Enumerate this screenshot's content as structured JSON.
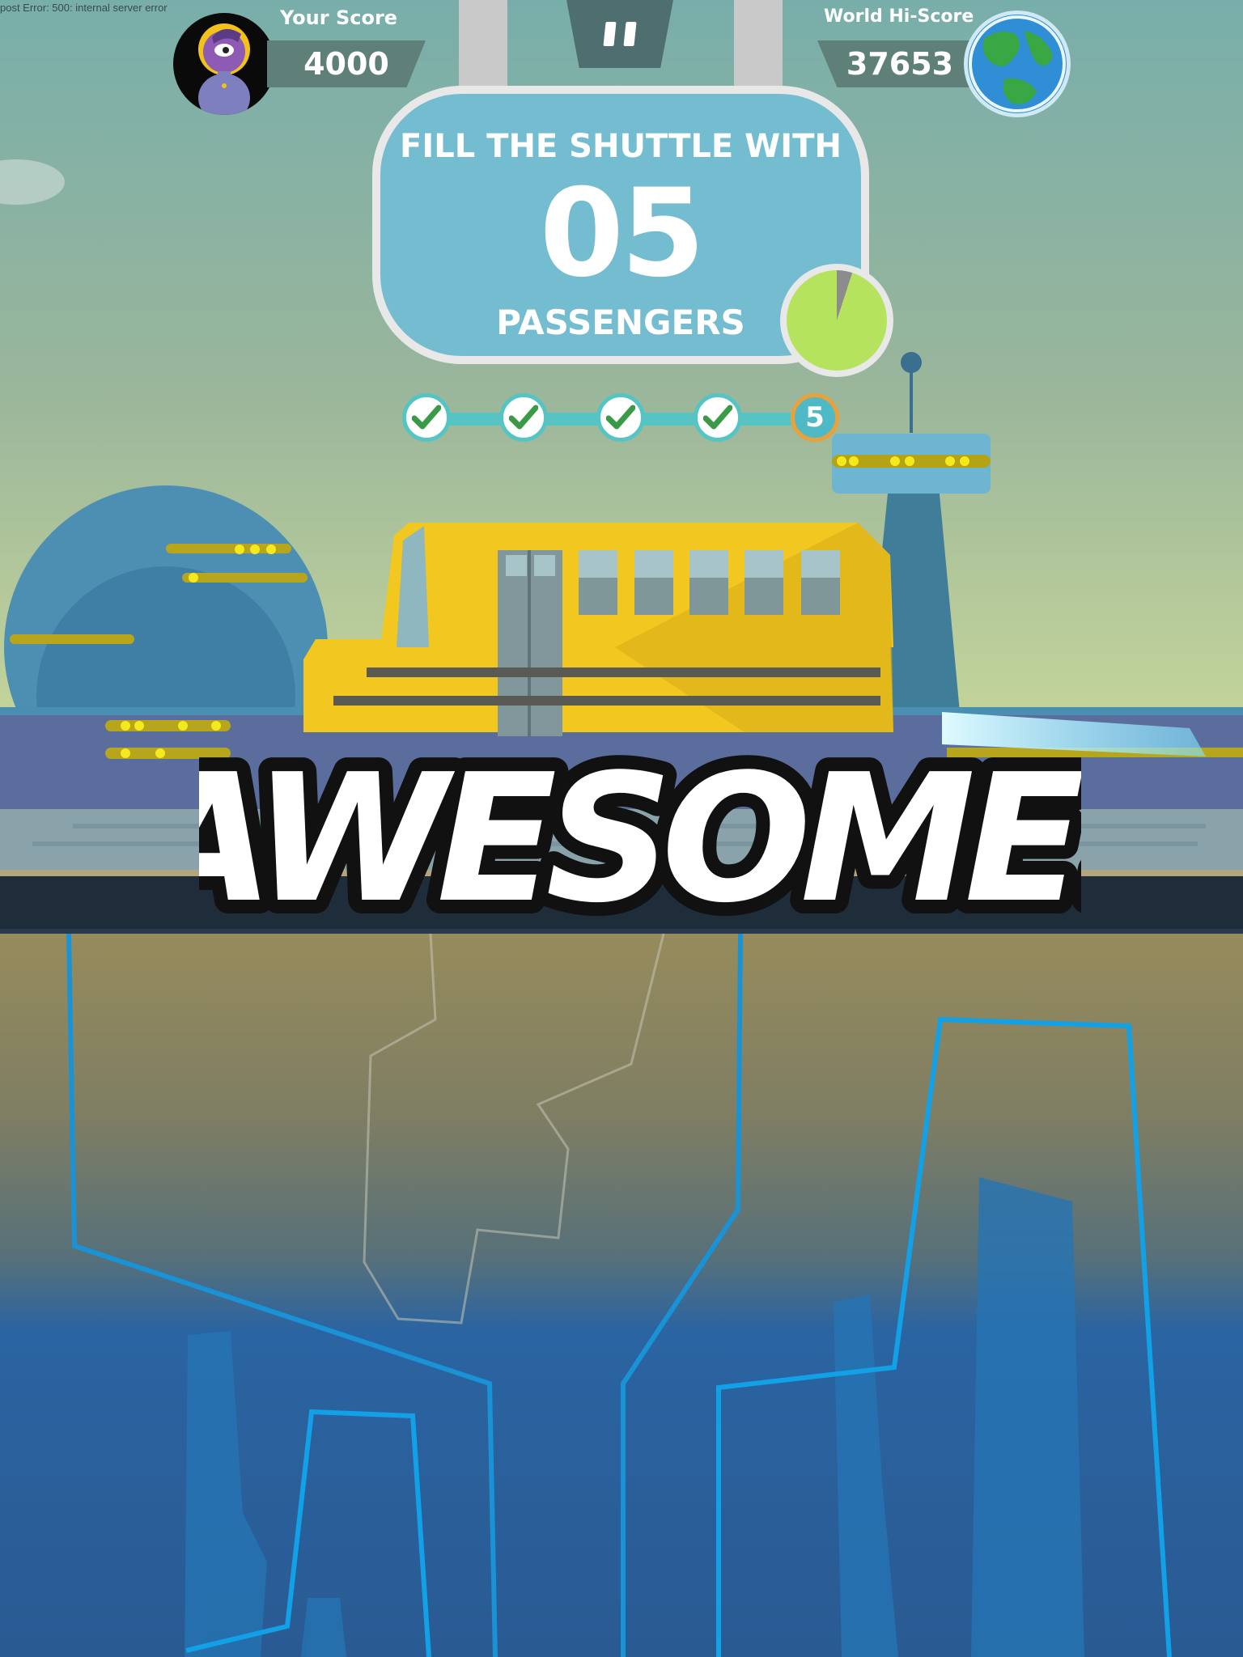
{
  "status_error": "post Error: 500: internal server error",
  "hud": {
    "your_score_label": "Your Score",
    "your_score": "4000",
    "world_hiscore_label": "World Hi-Score",
    "world_hiscore": "37653",
    "pause_icon": "pause-icon"
  },
  "mission": {
    "line1": "FILL THE SHUTTLE WITH",
    "count": "05",
    "line3": "PASSENGERS",
    "timer_remaining_fraction": 0.95
  },
  "progress": {
    "steps": [
      {
        "state": "done",
        "icon": "check-icon"
      },
      {
        "state": "done",
        "icon": "check-icon"
      },
      {
        "state": "done",
        "icon": "check-icon"
      },
      {
        "state": "done",
        "icon": "check-icon"
      },
      {
        "state": "current",
        "label": "5"
      }
    ]
  },
  "banner": "AWESOME!",
  "colors": {
    "sky_top": "#78aeaa",
    "sign": "#74bdd0",
    "timer": "#b5e35e",
    "bus": "#f2c71f",
    "check": "#3a9a45",
    "step_outline": "#e9a13c"
  }
}
